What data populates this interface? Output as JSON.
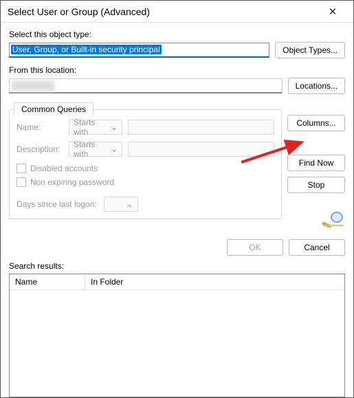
{
  "window": {
    "title": "Select User or Group (Advanced)"
  },
  "objectType": {
    "label": "Select this object type:",
    "value": "User, Group, or Built-in security principal",
    "button": "Object Types..."
  },
  "location": {
    "label": "From this location:",
    "button": "Locations..."
  },
  "queriesTab": {
    "title": "Common Queries",
    "nameLabel": "Name:",
    "nameCondition": "Starts with",
    "descLabel": "Description:",
    "descCondition": "Starts with",
    "disabledAccounts": "Disabled accounts",
    "nonExpiring": "Non expiring password",
    "daysLabel": "Days since last logon:"
  },
  "sideButtons": {
    "columns": "Columns...",
    "findNow": "Find Now",
    "stop": "Stop"
  },
  "actions": {
    "ok": "OK",
    "cancel": "Cancel"
  },
  "results": {
    "label": "Search results:",
    "colName": "Name",
    "colFolder": "In Folder"
  },
  "icons": {
    "close": "✕",
    "chevronDown": "⌄"
  }
}
